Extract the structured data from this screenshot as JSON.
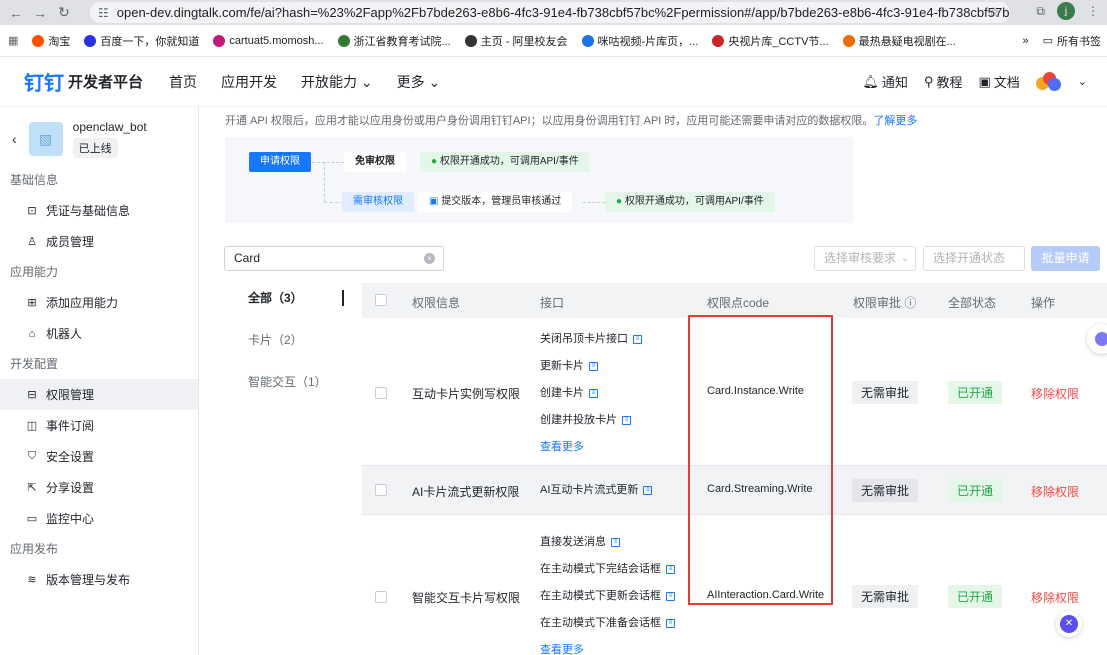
{
  "browser": {
    "url": "open-dev.dingtalk.com/fe/ai?hash=%23%2Fapp%2Fb7bde263-e8b6-4fc3-91e4-fb738cbf57bc%2Fpermission#/app/b7bde263-e8b6-4fc3-91e4-fb738cbf57bc/p...",
    "profile_initial": "j",
    "bookmarks": [
      "淘宝",
      "百度一下，你就知道",
      "cartuat5.momosh...",
      "浙江省教育考试院...",
      "主页 - 阿里校友会",
      "咪咕视频-片库页，...",
      "央视片库_CCTV节...",
      "最热悬疑电视剧在..."
    ],
    "bookmarks_folder": "所有书签",
    "bookmark_colors": [
      "#ff5000",
      "#2932e1",
      "#c2187e",
      "#2e7d32",
      "#333333",
      "#1a73e8",
      "#c62828",
      "#ef6c00"
    ]
  },
  "header": {
    "logo_mark": "钉钉",
    "logo_text": "开发者平台",
    "nav": [
      "首页",
      "应用开发",
      "开放能力",
      "更多"
    ],
    "notify": "通知",
    "tutorial": "教程",
    "docs": "文档"
  },
  "sidebar": {
    "app_name": "openclaw_bot",
    "app_status": "已上线",
    "groups": [
      {
        "title": "基础信息",
        "items": [
          "凭证与基础信息",
          "成员管理"
        ]
      },
      {
        "title": "应用能力",
        "items": [
          "添加应用能力",
          "机器人"
        ]
      },
      {
        "title": "开发配置",
        "items": [
          "权限管理",
          "事件订阅",
          "安全设置",
          "分享设置",
          "监控中心"
        ]
      },
      {
        "title": "应用发布",
        "items": [
          "版本管理与发布"
        ]
      }
    ],
    "active_item": "权限管理"
  },
  "main": {
    "intro": "开通 API 权限后，应用才能以应用身份或用户身份调用钉钉API；以应用身份调用钉钉 API 时，应用可能还需要申请对应的数据权限。",
    "intro_link": "了解更多",
    "flow": {
      "apply": "申请权限",
      "no_review": "免审权限",
      "need_review": "需审核权限",
      "submit_step": "提交版本，管理员审核通过",
      "success": "权限开通成功，可调用API/事件"
    },
    "search_value": "Card",
    "filter_review_placeholder": "选择审核要求",
    "filter_status_placeholder": "选择开通状态",
    "batch_button": "批量申请",
    "tabs": [
      "全部（3）",
      "卡片（2）",
      "智能交互（1）"
    ],
    "columns": [
      "权限信息",
      "接口",
      "权限点code",
      "权限审批",
      "全部状态",
      "操作"
    ],
    "rows": [
      {
        "name": "互动卡片实例写权限",
        "apis": [
          "关闭吊顶卡片接口",
          "更新卡片",
          "创建卡片",
          "创建并投放卡片"
        ],
        "more": "查看更多",
        "code": "Card.Instance.Write",
        "approval": "无需审批",
        "status": "已开通",
        "action": "移除权限"
      },
      {
        "name": "AI卡片流式更新权限",
        "apis": [
          "AI互动卡片流式更新"
        ],
        "code": "Card.Streaming.Write",
        "approval": "无需审批",
        "status": "已开通",
        "action": "移除权限"
      },
      {
        "name": "智能交互卡片写权限",
        "apis": [
          "直接发送消息",
          "在主动模式下完结会话框",
          "在主动模式下更新会话框",
          "在主动模式下准备会话框"
        ],
        "more": "查看更多",
        "code": "AIInteraction.Card.Write",
        "approval": "无需审批",
        "status": "已开通",
        "action": "移除权限"
      }
    ]
  },
  "colors": {
    "accent": "#1677ff",
    "success": "#22a647",
    "danger": "#f54a45",
    "highlight_box": "#e23d3d"
  }
}
